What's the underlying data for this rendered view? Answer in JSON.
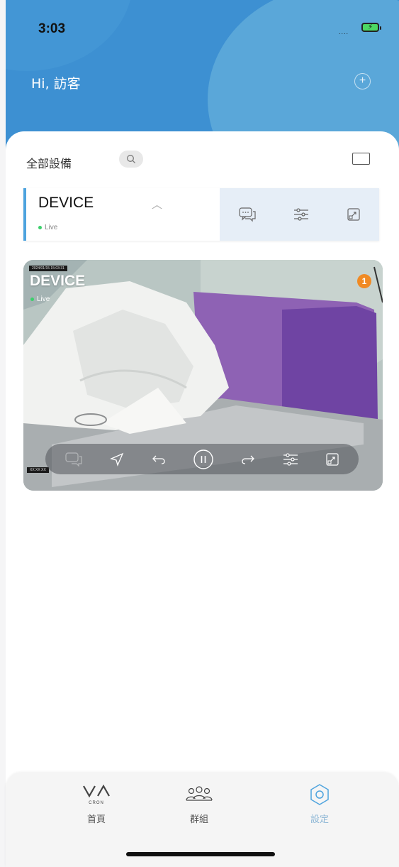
{
  "status_bar": {
    "time": "3:03",
    "signal": "....",
    "battery_icon": "battery-charging-icon"
  },
  "header": {
    "greeting": "Hi, 訪客",
    "add_icon": "plus-circle-icon"
  },
  "device_list": {
    "title": "全部設備",
    "search_icon": "search-icon",
    "layout_icon": "layout-toggle-icon"
  },
  "device": {
    "name": "DEVICE",
    "status": "Live",
    "toolbar_icons": [
      "chat-icon",
      "sliders-icon",
      "expand-icon"
    ]
  },
  "video": {
    "title": "DEVICE",
    "status": "Live",
    "timestamp_top": "2024/01/15 15:03:31",
    "timestamp_bottom": "XX XX XX",
    "notification_count": "1",
    "controls": [
      "chat-icon",
      "navigate-icon",
      "undo-icon",
      "pause-icon",
      "redo-icon",
      "sliders-icon",
      "expand-icon"
    ]
  },
  "bottom_nav": {
    "tabs": [
      {
        "label": "首頁",
        "icon": "vacron-logo-icon",
        "active": false
      },
      {
        "label": "群組",
        "icon": "group-icon",
        "active": false
      },
      {
        "label": "設定",
        "icon": "settings-icon",
        "active": true
      }
    ]
  },
  "colors": {
    "header_blue": "#3d90d2",
    "accent": "#4da3de",
    "live_green": "#3bd06b",
    "badge_orange": "#f08a24"
  }
}
